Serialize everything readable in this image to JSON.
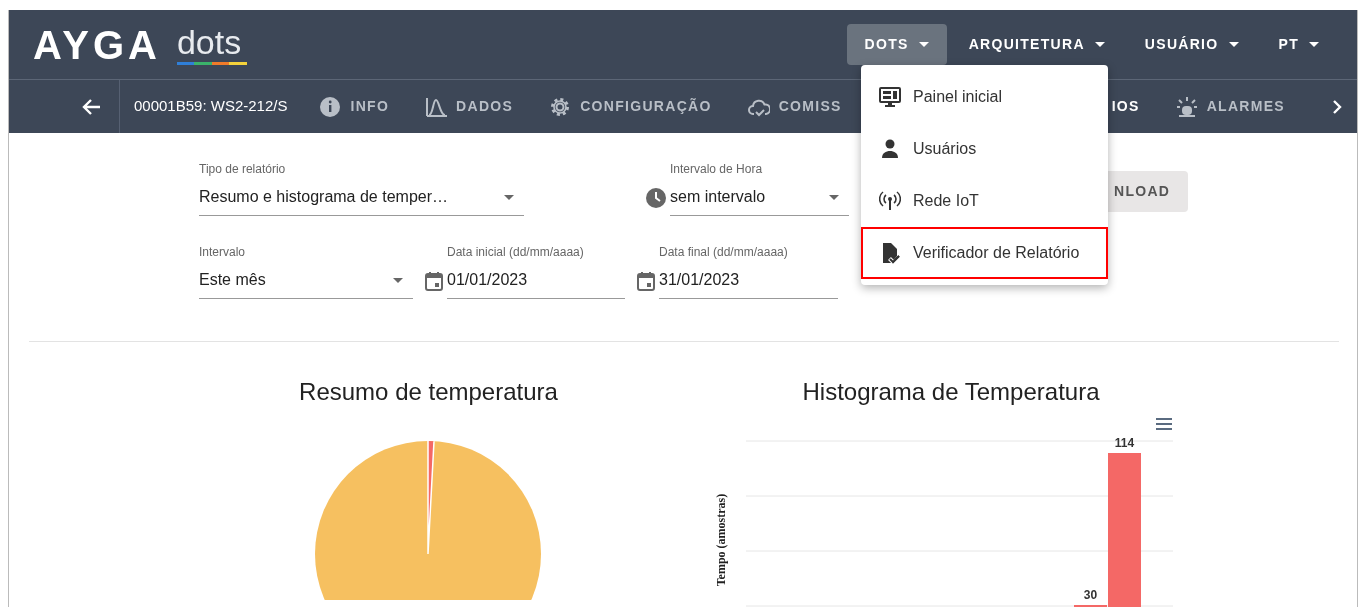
{
  "header": {
    "brand": "AYGA",
    "product": "dots",
    "menus": [
      {
        "label": "DOTS",
        "expanded": true
      },
      {
        "label": "ARQUITETURA",
        "expanded": false
      },
      {
        "label": "USUÁRIO",
        "expanded": false
      },
      {
        "label": "PT",
        "expanded": false
      }
    ]
  },
  "dropdown": {
    "items": [
      {
        "label": "Painel inicial",
        "highlighted": false
      },
      {
        "label": "Usuários",
        "highlighted": false
      },
      {
        "label": "Rede IoT",
        "highlighted": false
      },
      {
        "label": "Verificador de Relatório",
        "highlighted": true
      }
    ]
  },
  "subnav": {
    "device": "00001B59: WS2-212/S",
    "tabs_left": [
      {
        "label": "INFO",
        "selected": false
      },
      {
        "label": "DADOS",
        "selected": false
      },
      {
        "label": "CONFIGURAÇÃO",
        "selected": false
      },
      {
        "label": "COMISS",
        "selected": false
      }
    ],
    "tabs_right": [
      {
        "label": "IOS",
        "selected": true
      },
      {
        "label": "ALARMES",
        "selected": false
      }
    ]
  },
  "form": {
    "report_type": {
      "label": "Tipo de relatório",
      "value": "Resumo e histograma de temper…"
    },
    "hour_interval": {
      "label": "Intervalo de Hora",
      "value": "sem intervalo"
    },
    "download_button": "NLOAD",
    "interval": {
      "label": "Intervalo",
      "value": "Este mês"
    },
    "start_date": {
      "label": "Data inicial (dd/mm/aaaa)",
      "value": "01/01/2023"
    },
    "end_date": {
      "label": "Data final (dd/mm/aaaa)",
      "value": "31/01/2023"
    }
  },
  "summary_chart": {
    "title": "Resumo de temperatura"
  },
  "histogram": {
    "title": "Histograma de Temperatura",
    "ylabel": "Tempo (amostras)",
    "bar_labels": [
      "30",
      "114"
    ]
  }
}
